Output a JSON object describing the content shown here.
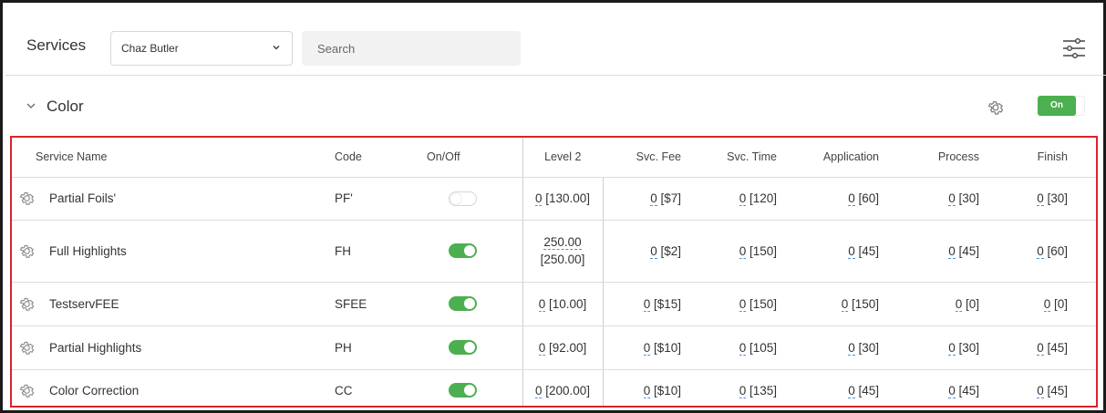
{
  "header": {
    "title": "Services",
    "staff_select": "Chaz Butler",
    "search_placeholder": "Search"
  },
  "section": {
    "title": "Color",
    "toggle_label": "On"
  },
  "table": {
    "columns": [
      "Service Name",
      "Code",
      "On/Off",
      "Level 2",
      "Svc. Fee",
      "Svc. Time",
      "Application",
      "Process",
      "Finish"
    ],
    "rows": [
      {
        "name": "Partial Foils'",
        "code": "PF'",
        "on": false,
        "l2_val": "0",
        "l2_def": "[130.00]",
        "fee_val": "0",
        "fee_def": "[$7]",
        "time_val": "0",
        "time_def": "[120]",
        "app_val": "0",
        "app_def": "[60]",
        "proc_val": "0",
        "proc_def": "[30]",
        "fin_val": "0",
        "fin_def": "[30]"
      },
      {
        "name": "Full Highlights",
        "code": "FH",
        "on": true,
        "l2_val": "250.00",
        "l2_def": "[250.00]",
        "fee_val": "0",
        "fee_def": "[$2]",
        "time_val": "0",
        "time_def": "[150]",
        "app_val": "0",
        "app_def": "[45]",
        "proc_val": "0",
        "proc_def": "[45]",
        "fin_val": "0",
        "fin_def": "[60]"
      },
      {
        "name": "TestservFEE",
        "code": "SFEE",
        "on": true,
        "l2_val": "0",
        "l2_def": "[10.00]",
        "fee_val": "0",
        "fee_def": "[$15]",
        "time_val": "0",
        "time_def": "[150]",
        "app_val": "0",
        "app_def": "[150]",
        "proc_val": "0",
        "proc_def": "[0]",
        "fin_val": "0",
        "fin_def": "[0]"
      },
      {
        "name": "Partial Highlights",
        "code": "PH",
        "on": true,
        "l2_val": "0",
        "l2_def": "[92.00]",
        "fee_val": "0",
        "fee_def": "[$10]",
        "time_val": "0",
        "time_def": "[105]",
        "app_val": "0",
        "app_def": "[30]",
        "proc_val": "0",
        "proc_def": "[30]",
        "fin_val": "0",
        "fin_def": "[45]"
      },
      {
        "name": "Color Correction",
        "code": "CC",
        "on": true,
        "l2_val": "0",
        "l2_def": "[200.00]",
        "fee_val": "0",
        "fee_def": "[$10]",
        "time_val": "0",
        "time_def": "[135]",
        "app_val": "0",
        "app_def": "[45]",
        "proc_val": "0",
        "proc_def": "[45]",
        "fin_val": "0",
        "fin_def": "[45]"
      }
    ]
  },
  "colors": {
    "accent_green": "#4caf50",
    "highlight_red": "#d9232e",
    "dotted_blue": "#4a90e2"
  }
}
